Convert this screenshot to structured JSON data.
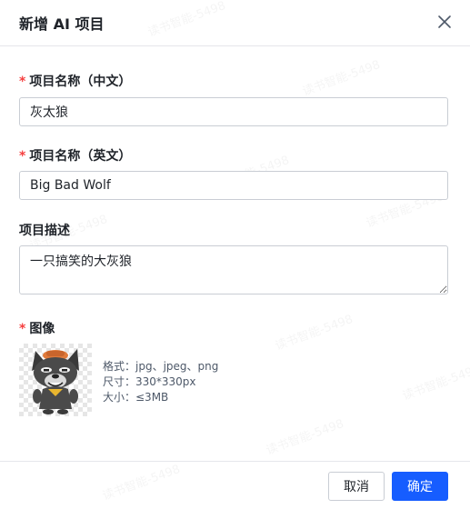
{
  "dialog": {
    "title": "新增 AI 项目",
    "close_icon": "close-icon"
  },
  "form": {
    "required_mark": "*",
    "name_cn": {
      "label": "项目名称（中文）",
      "value": "灰太狼"
    },
    "name_en": {
      "label": "项目名称（英文）",
      "value": "Big Bad Wolf"
    },
    "description": {
      "label": "项目描述",
      "value": "一只搞笑的大灰狼"
    },
    "image": {
      "label": "图像",
      "format": "格式：jpg、jpeg、png",
      "size": "尺寸：330*330px",
      "filesize": "大小：≤3MB"
    }
  },
  "footer": {
    "cancel_label": "取消",
    "ok_label": "确定"
  },
  "watermark": "读书智能-5498",
  "colors": {
    "primary": "#165dff",
    "required": "#f53f3f",
    "border": "#c9cdd4"
  }
}
